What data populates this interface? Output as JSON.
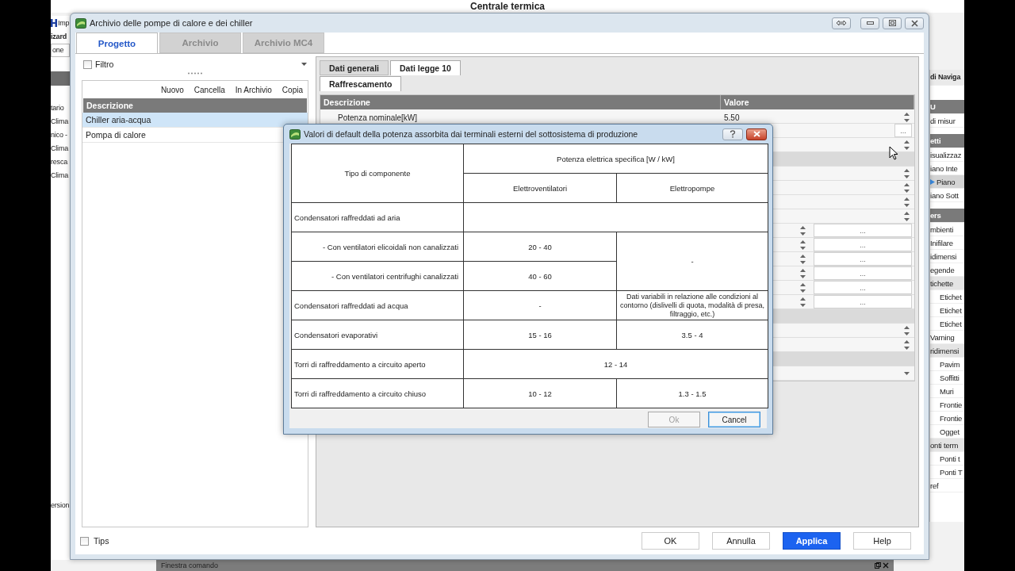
{
  "background_app": {
    "title": "Centrale termica",
    "left_items": [
      {
        "kind": "tool",
        "text": "Imp"
      },
      {
        "kind": "bold",
        "text": "izard"
      },
      {
        "kind": "field",
        "text": "one"
      },
      {
        "kind": "bar"
      },
      {
        "kind": "text",
        "text": "tario"
      },
      {
        "kind": "text",
        "text": "Clima"
      },
      {
        "kind": "text",
        "text": "nico -"
      },
      {
        "kind": "text",
        "text": "Clima"
      },
      {
        "kind": "text",
        "text": "resca"
      },
      {
        "kind": "text",
        "text": "Clima"
      },
      {
        "kind": "footer",
        "text": "ersion"
      }
    ],
    "right_items": [
      {
        "kind": "title",
        "text": "di Naviga"
      },
      {
        "kind": "header",
        "text": "U"
      },
      {
        "kind": "item",
        "text": "di misur",
        "selected": false
      },
      {
        "kind": "header",
        "text": "etti"
      },
      {
        "kind": "item",
        "text": "isualizzaz",
        "selected": false
      },
      {
        "kind": "item",
        "text": "iano Inte",
        "selected": false
      },
      {
        "kind": "item",
        "text": "Piano",
        "selected": true
      },
      {
        "kind": "item",
        "text": "iano Sott",
        "selected": false
      },
      {
        "kind": "header",
        "text": "ers"
      },
      {
        "kind": "item",
        "text": "mbienti",
        "selected": false
      },
      {
        "kind": "item",
        "text": "Inifilare",
        "selected": false
      },
      {
        "kind": "item",
        "text": "idimensi",
        "selected": false
      },
      {
        "kind": "item",
        "text": "egende",
        "selected": false
      },
      {
        "kind": "group",
        "text": "tichette",
        "selected": false
      },
      {
        "kind": "sub",
        "text": "Etichet",
        "selected": false
      },
      {
        "kind": "sub",
        "text": "Etichet",
        "selected": false
      },
      {
        "kind": "sub",
        "text": "Etichet",
        "selected": false
      },
      {
        "kind": "item",
        "text": "Varning",
        "selected": false
      },
      {
        "kind": "group",
        "text": "ridimensi",
        "selected": false
      },
      {
        "kind": "sub",
        "text": "Pavim",
        "selected": false
      },
      {
        "kind": "sub",
        "text": "Soffitti",
        "selected": false
      },
      {
        "kind": "sub",
        "text": "Muri",
        "selected": false
      },
      {
        "kind": "sub",
        "text": "Frontie",
        "selected": false
      },
      {
        "kind": "sub",
        "text": "Frontie",
        "selected": false
      },
      {
        "kind": "sub",
        "text": "Ogget",
        "selected": false
      },
      {
        "kind": "group",
        "text": "onti term",
        "selected": false
      },
      {
        "kind": "sub",
        "text": "Ponti t",
        "selected": false
      },
      {
        "kind": "sub",
        "text": "Ponti T",
        "selected": false
      },
      {
        "kind": "item",
        "text": "ref",
        "selected": false
      }
    ],
    "command_window": {
      "title": "Finestra comando"
    }
  },
  "window": {
    "title": "Archivio delle pompe di calore e dei chiller",
    "tabs": [
      {
        "label": "Progetto",
        "selected": true
      },
      {
        "label": "Archivio",
        "selected": false
      },
      {
        "label": "Archivio MC4",
        "selected": false
      }
    ],
    "left_panel": {
      "filter": {
        "label": "Filtro",
        "checked": false
      },
      "toolbar": [
        "Nuovo",
        "Cancella",
        "In Archivio",
        "Copia"
      ],
      "list": {
        "header": "Descrizione",
        "items": [
          {
            "label": "Chiller aria-acqua",
            "selected": true
          },
          {
            "label": "Pompa di calore",
            "selected": false
          }
        ]
      }
    },
    "right_panel": {
      "tabs": [
        {
          "label": "Dati generali",
          "selected": false
        },
        {
          "label": "Dati legge 10",
          "selected": true
        }
      ],
      "subtabs": [
        {
          "label": "Raffrescamento",
          "selected": true
        }
      ],
      "grid": {
        "columns": [
          "Descrizione",
          "Valore"
        ],
        "rows": [
          {
            "kind": "spin",
            "label": "Potenza nominale[kW]",
            "value": "5.50"
          },
          {
            "kind": "ellipsis",
            "button": "..."
          },
          {
            "kind": "spin"
          },
          {
            "kind": "group"
          },
          {
            "kind": "spin"
          },
          {
            "kind": "spin"
          },
          {
            "kind": "spin"
          },
          {
            "kind": "spin"
          },
          {
            "kind": "wide",
            "button": "..."
          },
          {
            "kind": "wide",
            "button": "..."
          },
          {
            "kind": "wide",
            "button": "..."
          },
          {
            "kind": "wide",
            "button": "..."
          },
          {
            "kind": "wide",
            "button": "..."
          },
          {
            "kind": "wide",
            "button": "..."
          },
          {
            "kind": "group"
          },
          {
            "kind": "spin"
          },
          {
            "kind": "spin"
          },
          {
            "kind": "group"
          },
          {
            "kind": "dropdown"
          }
        ]
      }
    },
    "footer": {
      "tips": {
        "label": "Tips",
        "checked": false
      },
      "buttons": [
        {
          "label": "OK",
          "kind": "normal"
        },
        {
          "label": "Annulla",
          "kind": "normal"
        },
        {
          "label": "Applica",
          "kind": "primary"
        },
        {
          "label": "Help",
          "kind": "normal"
        }
      ]
    }
  },
  "dialog": {
    "title": "Valori di default della potenza assorbita dai terminali esterni del sottosistema di produzione",
    "table": {
      "component_header": "Tipo di componente",
      "power_header": "Potenza elettrica specifica [W / kW]",
      "subheaders": [
        "Elettroventilatori",
        "Elettropompe"
      ],
      "rows": [
        {
          "kind": "group",
          "component": "Condensatori raffreddati ad aria"
        },
        {
          "kind": "sub",
          "component": "- Con ventilatori elicoidali non canalizzati",
          "fans": "20 - 40",
          "pumps": "-"
        },
        {
          "kind": "sub",
          "component": "- Con ventilatori centrifughi canalizzati",
          "fans": "40 - 60"
        },
        {
          "kind": "item",
          "component": "Condensatori raffreddati ad acqua",
          "fans": "-",
          "pumps": "Dati variabili in relazione alle condizioni al contorno (dislivelli di quota, modalità di presa, filtraggio, etc.)"
        },
        {
          "kind": "item",
          "component": "Condensatori evaporativi",
          "fans": "15 - 16",
          "pumps": "3.5 - 4"
        },
        {
          "kind": "shared",
          "component": "Torri di raffreddamento a circuito aperto",
          "value": "12 - 14"
        },
        {
          "kind": "item",
          "component": "Torri di raffreddamento a circuito chiuso",
          "fans": "10 - 12",
          "pumps": "1.3 - 1.5"
        }
      ]
    },
    "buttons": [
      {
        "label": "Ok",
        "disabled": true,
        "focused": false
      },
      {
        "label": "Cancel",
        "disabled": false,
        "focused": true
      }
    ]
  }
}
